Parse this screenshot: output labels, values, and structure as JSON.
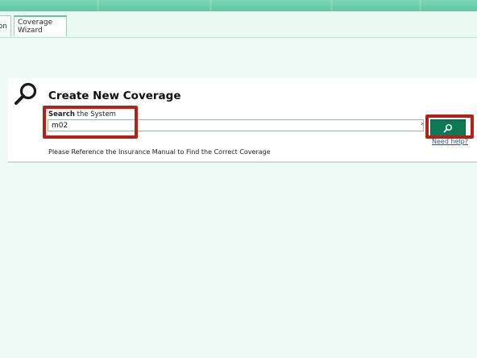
{
  "tabs": [
    {
      "label": "ion",
      "active": false
    },
    {
      "label": "Coverage Wizard",
      "active": true
    }
  ],
  "panel": {
    "icon": "search-icon",
    "title": "Create New Coverage",
    "search_label_bold": "Search",
    "search_label_rest": " the System",
    "search_value": "m02",
    "chevron": "›",
    "search_button_icon": "search-icon",
    "need_help": "Need help?",
    "reference_text": "Please Reference the Insurance Manual to Find the Correct Coverage"
  },
  "colors": {
    "accent_green": "#0e7a55",
    "band_green": "#6acda7",
    "highlight_red": "#b52116",
    "background": "#effbf6"
  }
}
